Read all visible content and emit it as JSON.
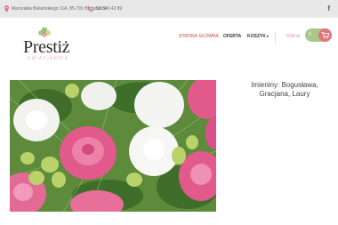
{
  "topbar": {
    "address": "Marszałka Bielańskiego 11A, 85-791 Bydgoszcz",
    "phone": "52 340 42 89",
    "facebook_glyph": "f"
  },
  "logo": {
    "name": "Prestiż",
    "tagline": "KWIACIARNIA"
  },
  "nav": {
    "items": [
      {
        "label": "STRONA GŁÓWNA",
        "active": true
      },
      {
        "label": "OFERTA",
        "active": false
      },
      {
        "label": "KOSZYK",
        "active": false
      }
    ]
  },
  "cart": {
    "amount": "0,00 zł",
    "count": "0"
  },
  "name_day": "Imieniny: Bogusława, Gracjana, Laury",
  "colors": {
    "accent": "#e2737f",
    "green": "#a9c88b",
    "topbar": "#e8e8e8"
  },
  "icons": [
    "map-pin-icon",
    "phone-icon",
    "facebook-icon",
    "chevron-down-icon",
    "cart-icon"
  ]
}
